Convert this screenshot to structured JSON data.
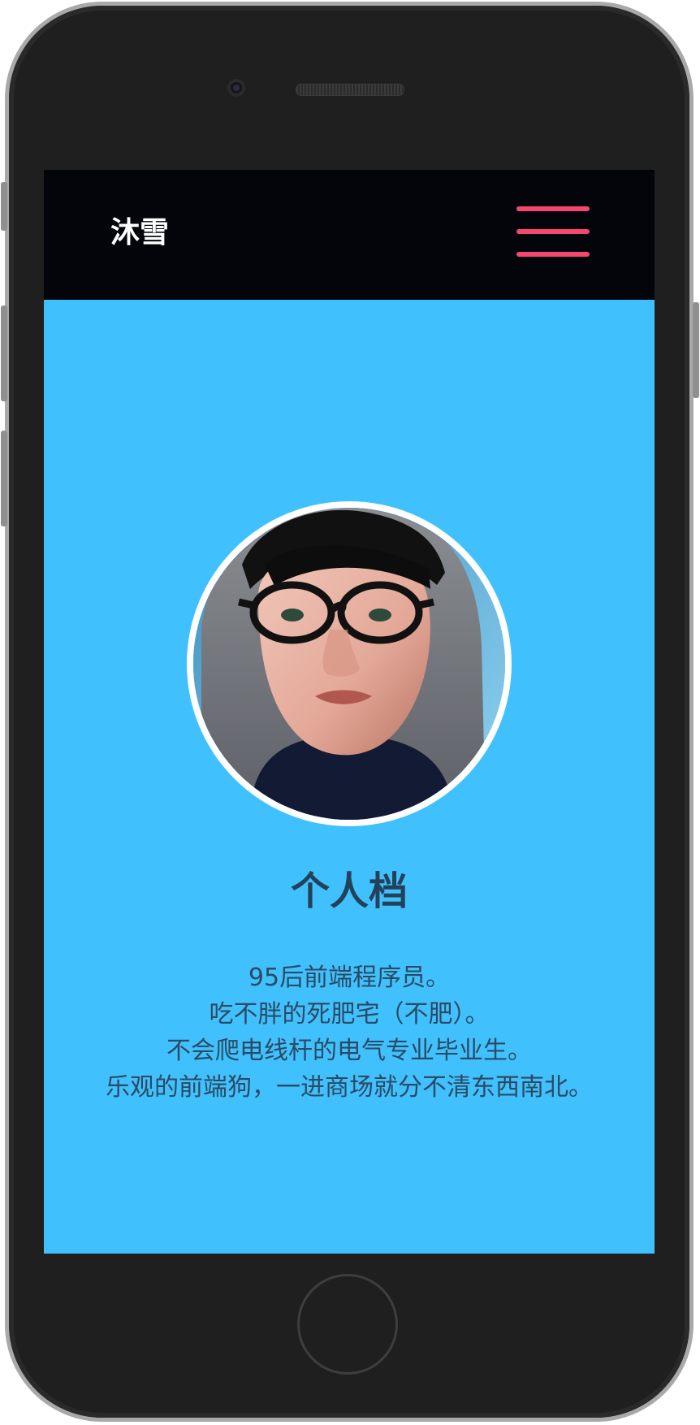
{
  "header": {
    "brand": "沐雪",
    "menu_icon": "hamburger-menu-icon",
    "menu_color": "#f5476d",
    "background": "#03050b"
  },
  "profile": {
    "avatar_alt": "avatar",
    "heading": "个人档",
    "bio_lines": [
      "95后前端程序员。",
      "吃不胖的死肥宅（不肥）。",
      "不会爬电线杆的电气专业毕业生。",
      "乐观的前端狗，一进商场就分不清东西南北。"
    ],
    "background": "#40c1fe"
  }
}
